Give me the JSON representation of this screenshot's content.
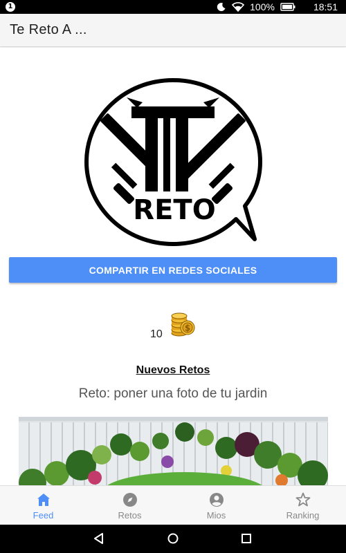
{
  "status_bar": {
    "notification_badge": "1",
    "battery": "100%",
    "time": "18:51",
    "icons": [
      "do-not-disturb-icon",
      "wifi-icon",
      "battery-icon"
    ]
  },
  "app_bar": {
    "title": "Te Reto A ..."
  },
  "logo": {
    "text": "RETO"
  },
  "share_button": {
    "label": "COMPARTIR EN REDES SOCIALES"
  },
  "coins": {
    "amount": "10",
    "icon": "gold-coins-icon"
  },
  "new_challenges": {
    "title": "Nuevos Retos",
    "challenge_text": "Reto: poner una foto de tu jardin"
  },
  "bottom_nav": {
    "items": [
      {
        "label": "Feed",
        "icon": "home-icon",
        "active": true
      },
      {
        "label": "Retos",
        "icon": "compass-icon",
        "active": false
      },
      {
        "label": "Mios",
        "icon": "account-icon",
        "active": false
      },
      {
        "label": "Ranking",
        "icon": "star-icon",
        "active": false
      }
    ]
  },
  "colors": {
    "accent": "#4d8ef7",
    "inactive": "#888888",
    "coin_gold": "#e0a21b"
  }
}
